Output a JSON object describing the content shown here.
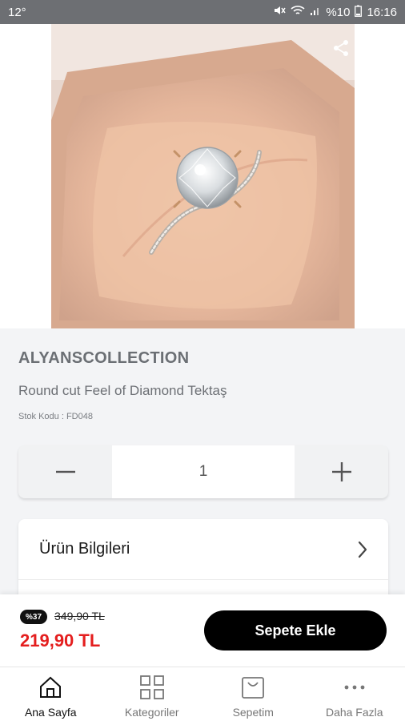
{
  "status_bar": {
    "left": "12°",
    "battery_text": "%10",
    "time": "16:16"
  },
  "hero": {
    "back_icon": "back-arrow-icon",
    "share_icon": "share-icon",
    "image_alt": "Round cut diamond solitaire ring in peach velvet box"
  },
  "product": {
    "brand": "ALYANSCOLLECTION",
    "name": "Round cut Feel of Diamond Tektaş",
    "stock_label": "Stok Kodu :",
    "stock_code": "FD048"
  },
  "quantity": {
    "value": "1",
    "minus_icon": "minus-icon",
    "plus_icon": "plus-icon"
  },
  "info_card": {
    "row_label": "Ürün Bilgileri",
    "chevron_icon": "chevron-right-icon"
  },
  "price": {
    "discount_badge": "%37",
    "old_price": "349,90 TL",
    "new_price": "219,90 TL",
    "add_to_cart": "Sepete Ekle",
    "colors": {
      "price": "#e41e1e",
      "button": "#000000"
    }
  },
  "bottom_nav": {
    "items": [
      {
        "label": "Ana Sayfa",
        "icon": "home-icon",
        "active": true
      },
      {
        "label": "Kategoriler",
        "icon": "grid-icon",
        "active": false
      },
      {
        "label": "Sepetim",
        "icon": "bag-icon",
        "active": false
      },
      {
        "label": "Daha Fazla",
        "icon": "more-icon",
        "active": false
      }
    ]
  }
}
